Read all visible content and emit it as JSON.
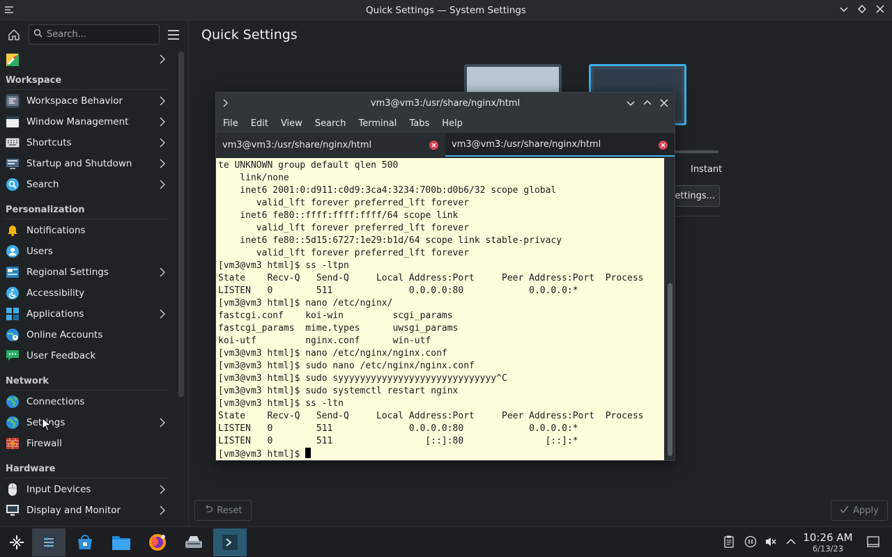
{
  "window": {
    "title": "Quick Settings — System Settings"
  },
  "sidebar": {
    "search_placeholder": "Search...",
    "top_item": {
      "icon": "appearance-icon"
    },
    "sections": [
      {
        "label": "Workspace",
        "items": [
          {
            "label": "Workspace Behavior",
            "icon": "workspace-behavior-icon",
            "chevron": true
          },
          {
            "label": "Window Management",
            "icon": "window-management-icon",
            "chevron": true
          },
          {
            "label": "Shortcuts",
            "icon": "keyboard-icon",
            "chevron": true
          },
          {
            "label": "Startup and Shutdown",
            "icon": "startup-icon",
            "chevron": true
          },
          {
            "label": "Search",
            "icon": "search-icon",
            "chevron": true
          }
        ]
      },
      {
        "label": "Personalization",
        "items": [
          {
            "label": "Notifications",
            "icon": "bell-icon",
            "chevron": false
          },
          {
            "label": "Users",
            "icon": "user-icon",
            "chevron": false
          },
          {
            "label": "Regional Settings",
            "icon": "regional-icon",
            "chevron": true
          },
          {
            "label": "Accessibility",
            "icon": "accessibility-icon",
            "chevron": false
          },
          {
            "label": "Applications",
            "icon": "applications-icon",
            "chevron": true
          },
          {
            "label": "Online Accounts",
            "icon": "online-accounts-icon",
            "chevron": false
          },
          {
            "label": "User Feedback",
            "icon": "feedback-icon",
            "chevron": false
          }
        ]
      },
      {
        "label": "Network",
        "items": [
          {
            "label": "Connections",
            "icon": "globe-icon",
            "chevron": false
          },
          {
            "label": "Settings",
            "icon": "globe-icon",
            "chevron": true
          },
          {
            "label": "Firewall",
            "icon": "firewall-icon",
            "chevron": false
          }
        ]
      },
      {
        "label": "Hardware",
        "items": [
          {
            "label": "Input Devices",
            "icon": "mouse-icon",
            "chevron": true
          },
          {
            "label": "Display and Monitor",
            "icon": "monitor-icon",
            "chevron": true
          }
        ]
      }
    ]
  },
  "main": {
    "title": "Quick Settings",
    "instant_label": "Instant",
    "settings_button": "Settings...",
    "reset_label": "Reset",
    "apply_label": "Apply"
  },
  "konsole": {
    "title": "vm3@vm3:/usr/share/nginx/html",
    "menu": [
      "File",
      "Edit",
      "View",
      "Search",
      "Terminal",
      "Tabs",
      "Help"
    ],
    "tabs": [
      {
        "label": "vm3@vm3:/usr/share/nginx/html"
      },
      {
        "label": "vm3@vm3:/usr/share/nginx/html"
      }
    ],
    "lines": [
      "te UNKNOWN group default qlen 500",
      "    link/none",
      "    inet6 2001:0:d911:c0d9:3ca4:3234:700b:d0b6/32 scope global",
      "       valid_lft forever preferred_lft forever",
      "    inet6 fe80::ffff:ffff:ffff/64 scope link",
      "       valid_lft forever preferred_lft forever",
      "    inet6 fe80::5d15:6727:1e29:b1d/64 scope link stable-privacy",
      "       valid_lft forever preferred_lft forever",
      "[vm3@vm3 html]$ ss -ltpn",
      "State    Recv-Q   Send-Q     Local Address:Port     Peer Address:Port  Process",
      "LISTEN   0        511              0.0.0.0:80            0.0.0.0:*",
      "[vm3@vm3 html]$ nano /etc/nginx/",
      "fastcgi.conf    koi-win         scgi_params",
      "fastcgi_params  mime.types      uwsgi_params",
      "koi-utf         nginx.conf      win-utf",
      "[vm3@vm3 html]$ nano /etc/nginx/nginx.conf",
      "[vm3@vm3 html]$ sudo nano /etc/nginx/nginx.conf",
      "[vm3@vm3 html]$ sudo syyyyyyyyyyyyyyyyyyyyyyyyyyyyy^C",
      "[vm3@vm3 html]$ sudo systemctl restart nginx",
      "[vm3@vm3 html]$ ss -ltn",
      "State    Recv-Q   Send-Q     Local Address:Port     Peer Address:Port  Process",
      "LISTEN   0        511              0.0.0.0:80            0.0.0.0:*",
      "LISTEN   0        511                 [::]:80               [::]:*"
    ],
    "prompt": "[vm3@vm3 html]$ "
  },
  "taskbar": {
    "time": "10:26 AM",
    "date": "6/13/23"
  }
}
